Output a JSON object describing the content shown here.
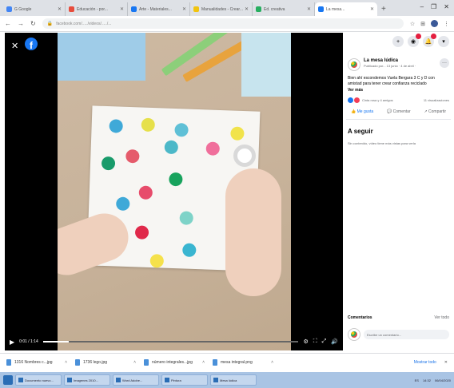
{
  "browser": {
    "tabs": [
      {
        "label": "G  Google",
        "color": "#4285f4",
        "active": false
      },
      {
        "label": "Educación - por...",
        "color": "#e74c3c",
        "active": false
      },
      {
        "label": "Arte - Materiales...",
        "color": "#1877f2",
        "active": false
      },
      {
        "label": "Manualidades - Crear...",
        "color": "#f1c40f",
        "active": false
      },
      {
        "label": "Ed. creativa",
        "color": "#27ae60",
        "active": false
      },
      {
        "label": "La mesa...",
        "color": "#1877f2",
        "active": true
      }
    ],
    "new_tab": "+",
    "url": "facebook.com/...../videos/...../...",
    "win_controls": [
      "–",
      "❐",
      "✕"
    ]
  },
  "video": {
    "close": "✕",
    "fb_logo": "f",
    "time": "0:01 / 1:14",
    "progress": 0.1,
    "dots": [
      {
        "color": "#3fa9d8",
        "l": 8,
        "t": 8
      },
      {
        "color": "#e6e04a",
        "l": 48,
        "t": 5
      },
      {
        "color": "#5fc0d6",
        "l": 90,
        "t": 10
      },
      {
        "color": "#f1e34b",
        "l": 160,
        "t": 12
      },
      {
        "color": "#e55b6b",
        "l": 30,
        "t": 45
      },
      {
        "color": "#199b6a",
        "l": 0,
        "t": 55
      },
      {
        "color": "#4cb8c8",
        "l": 78,
        "t": 32
      },
      {
        "color": "#f06f9b",
        "l": 130,
        "t": 32
      },
      {
        "color": "#18a35d",
        "l": 85,
        "t": 72
      },
      {
        "color": "#e74c6b",
        "l": 48,
        "t": 90
      },
      {
        "color": "#3fa9d8",
        "l": 20,
        "t": 105
      },
      {
        "color": "#7ed3c8",
        "l": 100,
        "t": 120
      },
      {
        "color": "#e0294a",
        "l": 45,
        "t": 140
      },
      {
        "color": "#19a35d",
        "l": 0,
        "t": 150
      },
      {
        "color": "#3ab5d0",
        "l": 105,
        "t": 160
      },
      {
        "color": "#f5e14b",
        "l": 65,
        "t": 175
      },
      {
        "color": "#d8433d",
        "l": 160,
        "t": 170
      }
    ]
  },
  "panel": {
    "page_name": "La mesa lúdica",
    "page_meta": "Publicado por... 13 junio · 4 de abril ·",
    "description": "Bien ahí escondemos Vuela Bergara 3 C y D con amistad para tener crear confianza reciclado",
    "see_more": "Ver más",
    "stats_left": "Cinta rosa y 4 amigos",
    "stats_right": "11 visualizaciones",
    "actions": {
      "like": "Me gusta",
      "comment": "Comentar",
      "share": "Compartir"
    },
    "next_title": "A seguir",
    "next_text": "Sin contenido, vídeo tiene más vistas para verla",
    "comments_title": "Comentarios",
    "comments_right": "Ver todo",
    "comment_placeholder": "Escribe un comentario..."
  },
  "downloads": {
    "items": [
      "1316 Nombres c...jpg",
      "1736 lego.jpg",
      "número integrales...jpg",
      "mesa integral.png"
    ],
    "show_all": "Mostrar todo",
    "close": "✕"
  },
  "taskbar": {
    "items": [
      "Documento nuevo...",
      "Imagenes 2010...",
      "Word Adobe...",
      "Pintura",
      "Mesa lúdica"
    ],
    "tray": [
      "ES",
      "14:32",
      "06/04/2020"
    ]
  }
}
